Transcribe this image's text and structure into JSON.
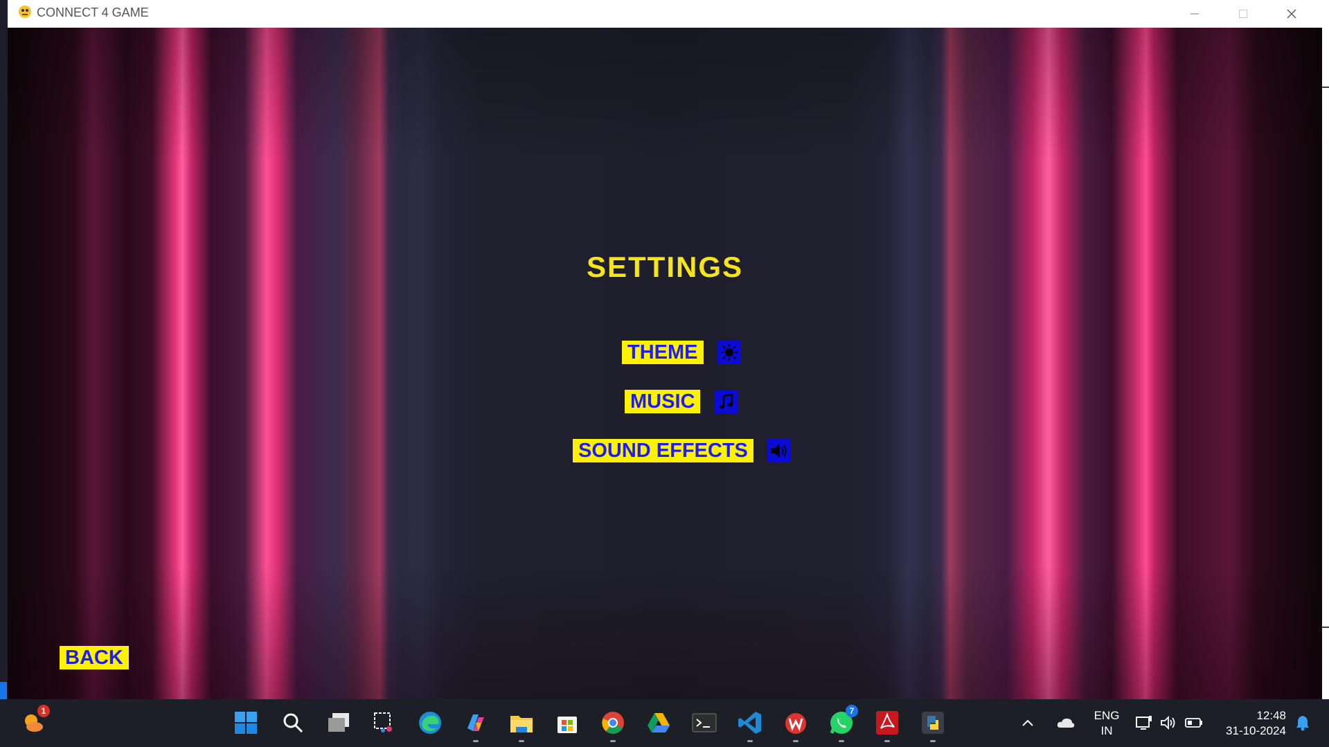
{
  "window": {
    "title": "CONNECT 4 GAME"
  },
  "settings": {
    "title": "SETTINGS",
    "theme_label": "THEME",
    "music_label": "MUSIC",
    "sound_effects_label": "SOUND EFFECTS",
    "back_label": "BACK"
  },
  "colors": {
    "title_yellow": "#f6e51b",
    "button_bg": "#fff200",
    "button_text": "#1d1df0",
    "icon_box": "#0b0bd6",
    "background": "#1e1e2a",
    "curtain_pink": "#ff5fa0"
  },
  "taskbar": {
    "weather_badge": "1",
    "whatsapp_badge": "7",
    "language": "ENG",
    "region": "IN",
    "time": "12:48",
    "date": "31-10-2024"
  }
}
